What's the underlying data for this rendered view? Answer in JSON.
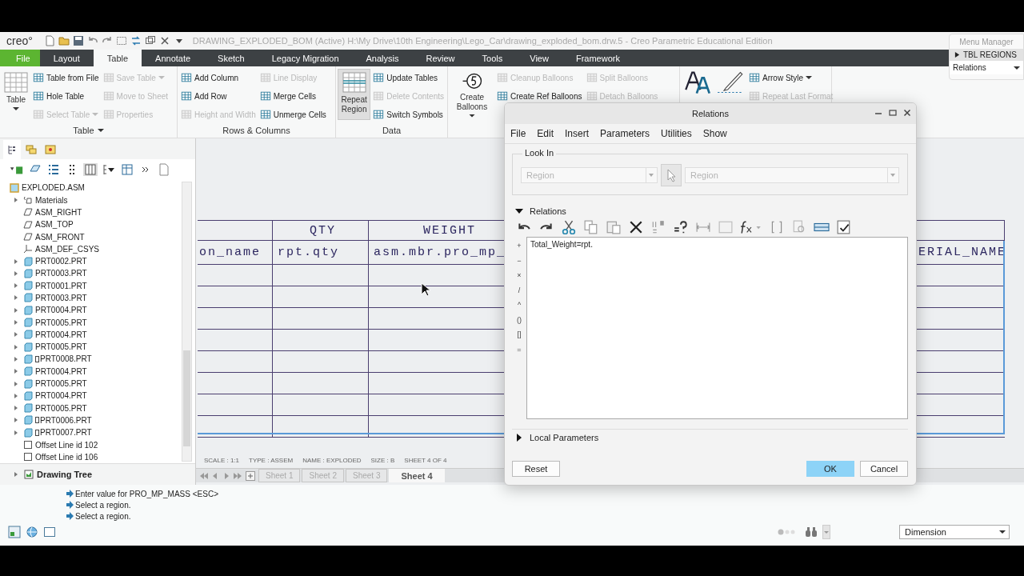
{
  "title_bar": {
    "logo": "creo°",
    "title": "DRAWING_EXPLODED_BOM (Active) H:\\My Drive\\10th Engineering\\Lego_Car\\drawing_exploded_bom.drw.5 - Creo Parametric Educational Edition"
  },
  "menu_tabs": [
    {
      "label": "File",
      "kind": "file",
      "selected": false
    },
    {
      "label": "Layout",
      "kind": "tab",
      "selected": false
    },
    {
      "label": "Table",
      "kind": "tab",
      "selected": true
    },
    {
      "label": "Annotate",
      "kind": "tab",
      "selected": false
    },
    {
      "label": "Sketch",
      "kind": "tab",
      "selected": false
    },
    {
      "label": "Legacy Migration",
      "kind": "tab",
      "selected": false
    },
    {
      "label": "Analysis",
      "kind": "tab",
      "selected": false
    },
    {
      "label": "Review",
      "kind": "tab",
      "selected": false
    },
    {
      "label": "Tools",
      "kind": "tab",
      "selected": false
    },
    {
      "label": "View",
      "kind": "tab",
      "selected": false
    },
    {
      "label": "Framework",
      "kind": "tab",
      "selected": false
    }
  ],
  "ribbon": {
    "groups": [
      {
        "label": "Table",
        "has_menu": true,
        "large": [
          {
            "kind": "table",
            "label": "Table",
            "has_menu": true,
            "pressed": false
          }
        ],
        "columns": [
          [
            {
              "label": "Table from File",
              "disabled": false
            },
            {
              "label": "Hole Table",
              "disabled": false
            },
            {
              "label": "Select Table",
              "disabled": true,
              "has_menu": true
            }
          ],
          [
            {
              "label": "Save Table",
              "disabled": true,
              "has_menu": true
            },
            {
              "label": "Move to Sheet",
              "disabled": true
            },
            {
              "label": "Properties",
              "disabled": true
            }
          ]
        ]
      },
      {
        "label": "Rows & Columns",
        "columns": [
          [
            {
              "label": "Add Column",
              "disabled": false
            },
            {
              "label": "Add Row",
              "disabled": false
            },
            {
              "label": "Height and Width",
              "disabled": true
            }
          ],
          [
            {
              "label": "Line Display",
              "disabled": true
            },
            {
              "label": "Merge Cells",
              "disabled": false
            },
            {
              "label": "Unmerge Cells",
              "disabled": false
            }
          ]
        ]
      },
      {
        "label": "Data",
        "large": [
          {
            "kind": "repeat_region",
            "label": "Repeat Region",
            "pressed": true
          }
        ],
        "columns": [
          [
            {
              "label": "Update Tables",
              "disabled": false
            },
            {
              "label": "Delete Contents",
              "disabled": true
            },
            {
              "label": "Switch Symbols",
              "disabled": false
            }
          ]
        ]
      },
      {
        "large": [
          {
            "kind": "balloon",
            "label": "Create Balloons",
            "has_menu": true,
            "pressed": false
          }
        ],
        "columns": [
          [
            {
              "label": "Cleanup Balloons",
              "disabled": true
            },
            {
              "label": "Create Ref Balloons",
              "disabled": false
            }
          ],
          [
            {
              "label": "Split Balloons",
              "disabled": true
            },
            {
              "label": "Detach Balloons",
              "disabled": true
            }
          ]
        ]
      },
      {
        "large": [
          {
            "kind": "text_style",
            "pressed": false
          },
          {
            "kind": "pen",
            "pressed": false
          }
        ],
        "columns": [
          [
            {
              "label": "Arrow Style",
              "disabled": false,
              "has_menu": true
            },
            {
              "label": "Repeat Last Format",
              "disabled": true
            }
          ]
        ]
      }
    ]
  },
  "tree": {
    "tabs": [
      {
        "selected": true
      },
      {
        "selected": false
      },
      {
        "selected": false
      }
    ],
    "root": {
      "label": "EXPLODED.ASM",
      "kind": "assembly",
      "children": [
        {
          "label": "Materials",
          "kind": "materials",
          "expandable": true,
          "flagged": false
        },
        {
          "label": "ASM_RIGHT",
          "kind": "plane",
          "expandable": false,
          "flagged": false
        },
        {
          "label": "ASM_TOP",
          "kind": "plane",
          "expandable": false,
          "flagged": false
        },
        {
          "label": "ASM_FRONT",
          "kind": "plane",
          "expandable": false,
          "flagged": false
        },
        {
          "label": "ASM_DEF_CSYS",
          "kind": "csys",
          "expandable": false,
          "flagged": false
        },
        {
          "label": "PRT0002.PRT",
          "kind": "part",
          "expandable": true,
          "flagged": false
        },
        {
          "label": "PRT0003.PRT",
          "kind": "part",
          "expandable": true,
          "flagged": false
        },
        {
          "label": "PRT0001.PRT",
          "kind": "part",
          "expandable": true,
          "flagged": false
        },
        {
          "label": "PRT0003.PRT",
          "kind": "part",
          "expandable": true,
          "flagged": false
        },
        {
          "label": "PRT0004.PRT",
          "kind": "part",
          "expandable": true,
          "flagged": false
        },
        {
          "label": "PRT0005.PRT",
          "kind": "part",
          "expandable": true,
          "flagged": false
        },
        {
          "label": "PRT0004.PRT",
          "kind": "part",
          "expandable": true,
          "flagged": false
        },
        {
          "label": "PRT0005.PRT",
          "kind": "part",
          "expandable": true,
          "flagged": false
        },
        {
          "label": "PRT0008.PRT",
          "kind": "part",
          "expandable": true,
          "flagged": true
        },
        {
          "label": "PRT0004.PRT",
          "kind": "part",
          "expandable": true,
          "flagged": false
        },
        {
          "label": "PRT0005.PRT",
          "kind": "part",
          "expandable": true,
          "flagged": false
        },
        {
          "label": "PRT0004.PRT",
          "kind": "part",
          "expandable": true,
          "flagged": false
        },
        {
          "label": "PRT0005.PRT",
          "kind": "part",
          "expandable": true,
          "flagged": false
        },
        {
          "label": "PRT0006.PRT",
          "kind": "part",
          "expandable": true,
          "flagged": true
        },
        {
          "label": "PRT0007.PRT",
          "kind": "part",
          "expandable": true,
          "flagged": true
        },
        {
          "label": "Offset Line id 102",
          "kind": "offset",
          "expandable": false,
          "flagged": false
        },
        {
          "label": "Offset Line id 106",
          "kind": "offset",
          "expandable": false,
          "flagged": false
        }
      ]
    },
    "drawing_tree": {
      "label": "Drawing Tree",
      "expanded": false
    }
  },
  "drawing": {
    "columns": [
      {
        "value": "on_name"
      },
      {
        "header": "QTY",
        "value": "rpt.qty"
      },
      {
        "header": "WEIGHT",
        "value": "asm.mbr.pro_mp_"
      },
      {
        "value": "ERIAL_NAME"
      }
    ],
    "format_info": [
      "SCALE : 1:1",
      "TYPE : ASSEM",
      "NAME : EXPLODED",
      "SIZE : B",
      "SHEET 4 OF 4"
    ],
    "sheets": [
      {
        "label": "Sheet 1",
        "selected": false
      },
      {
        "label": "Sheet 2",
        "selected": false
      },
      {
        "label": "Sheet 3",
        "selected": false
      },
      {
        "label": "Sheet 4",
        "selected": true
      }
    ]
  },
  "messages": [
    {
      "text": "Enter value for PRO_MP_MASS  <ESC>"
    },
    {
      "text": "Select a region."
    },
    {
      "text": "Select a region."
    }
  ],
  "status": {
    "filter": "Dimension"
  },
  "menu_manager": {
    "title": "Menu Manager",
    "items": [
      {
        "label": "TBL REGIONS",
        "kind": "header"
      },
      {
        "label": "Relations",
        "kind": "dropdown"
      }
    ]
  },
  "dialog": {
    "title": "Relations",
    "menu": [
      "File",
      "Edit",
      "Insert",
      "Parameters",
      "Utilities",
      "Show"
    ],
    "look_in": {
      "label": "Look In",
      "type": "Region",
      "item": "Region",
      "disabled": true
    },
    "relations": {
      "label": "Relations",
      "expanded": true,
      "operators": [
        "+",
        "−",
        "×",
        "/",
        "^",
        "()",
        "[]",
        "="
      ],
      "value": "Total_Weight=rpt."
    },
    "local_parameters": {
      "label": "Local Parameters",
      "expanded": false
    },
    "buttons": [
      {
        "label": "Reset",
        "primary": false
      },
      {
        "label": "OK",
        "primary": true
      },
      {
        "label": "Cancel",
        "primary": false
      }
    ]
  }
}
